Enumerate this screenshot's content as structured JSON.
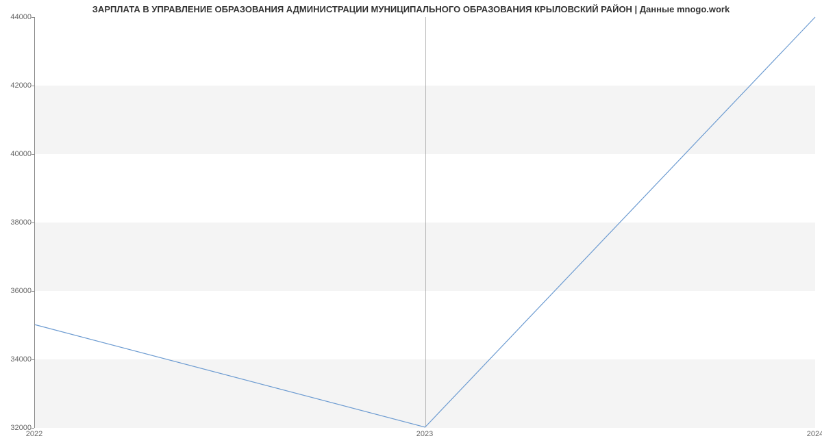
{
  "chart_data": {
    "type": "line",
    "title": "ЗАРПЛАТА В УПРАВЛЕНИЕ ОБРАЗОВАНИЯ АДМИНИСТРАЦИИ МУНИЦИПАЛЬНОГО ОБРАЗОВАНИЯ КРЫЛОВСКИЙ РАЙОН | Данные mnogo.work",
    "xlabel": "",
    "ylabel": "",
    "x": [
      2022,
      2023,
      2024
    ],
    "values": [
      35000,
      32000,
      44000
    ],
    "x_ticks": [
      2022,
      2023,
      2024
    ],
    "y_ticks": [
      32000,
      34000,
      36000,
      38000,
      40000,
      42000,
      44000
    ],
    "ylim": [
      32000,
      44000
    ],
    "xlim": [
      2022,
      2024
    ],
    "line_color": "#6c9bd1",
    "grid_bands": true
  }
}
